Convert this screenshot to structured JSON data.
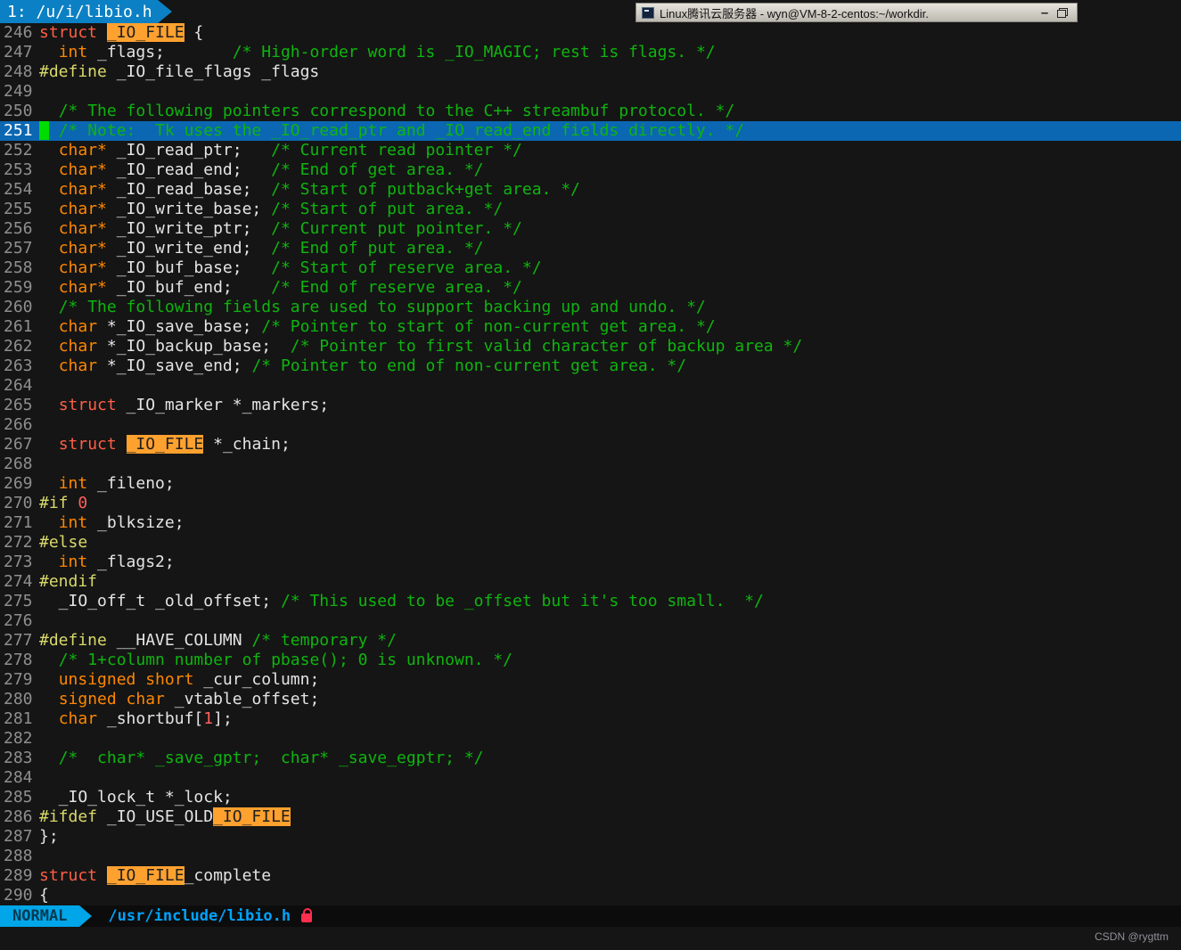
{
  "colors": {
    "bg": "#151515",
    "gutter_fg": "#8f8f8f",
    "text": "#e4e4e4",
    "comment": "#0fb40f",
    "type": "#ff8700",
    "keyword": "#ff5f45",
    "preproc": "#d8d96a",
    "number": "#ff5f5f",
    "search_bg": "#ffa12f",
    "search_fg": "#1f1f1f",
    "cursorline_bg": "#0b67b2",
    "cursorline_num": "#ffffff",
    "cursor_bg": "#00dc00",
    "tab_bg": "#0c80c4",
    "tab_fg": "#ffffff",
    "mode_bg": "#00a6e8",
    "mode_fg": "#063a52",
    "path_fg": "#00a4ff",
    "statusbar_bg": "#0c0c0c",
    "lock_red": "#ff2e4e",
    "titlebar_bg1": "#e6e3dc",
    "titlebar_bg2": "#bcb9b0",
    "watermark_fg": "#90909a"
  },
  "tabline": {
    "active_tab": "1: /u/i/libio.h"
  },
  "titlebar": {
    "title": "Linux腾讯云服务器 - wyn@VM-8-2-centos:~/workdir.",
    "minimize_glyph": "–",
    "app_icon": "terminal-icon",
    "restore_icon": "restore-window-icon"
  },
  "statusbar": {
    "mode": "NORMAL",
    "file_path": "/usr/include/libio.h",
    "readonly_icon": "lock-icon"
  },
  "watermark": "CSDN @rygttm",
  "editor": {
    "cursor_line": 251,
    "search_term": "_IO_FILE",
    "lines": [
      {
        "num": "246",
        "tokens": [
          [
            "struct ",
            "k"
          ],
          [
            "_IO_FILE",
            "h"
          ],
          [
            " {",
            "w"
          ]
        ]
      },
      {
        "num": "247",
        "tokens": [
          [
            "  ",
            "w"
          ],
          [
            "int",
            "t"
          ],
          [
            " _flags;       ",
            "w"
          ],
          [
            "/* High-order word is _IO_MAGIC; rest is flags. */",
            "c"
          ]
        ]
      },
      {
        "num": "248",
        "tokens": [
          [
            "#define",
            "p"
          ],
          [
            " _IO_file_flags _flags",
            "w"
          ]
        ]
      },
      {
        "num": "249",
        "tokens": []
      },
      {
        "num": "250",
        "tokens": [
          [
            "  ",
            "w"
          ],
          [
            "/* The following pointers correspond to the C++ streambuf protocol. */",
            "c"
          ]
        ]
      },
      {
        "num": "251",
        "cursorline": true,
        "tokens": [
          [
            " ",
            "cur"
          ],
          [
            " ",
            "w"
          ],
          [
            "/* Note:  Tk uses the _IO_read_ptr and _IO_read_end fields directly. */",
            "c"
          ]
        ]
      },
      {
        "num": "252",
        "tokens": [
          [
            "  ",
            "w"
          ],
          [
            "char*",
            "t"
          ],
          [
            " _IO_read_ptr;   ",
            "w"
          ],
          [
            "/* Current read pointer */",
            "c"
          ]
        ]
      },
      {
        "num": "253",
        "tokens": [
          [
            "  ",
            "w"
          ],
          [
            "char*",
            "t"
          ],
          [
            " _IO_read_end;   ",
            "w"
          ],
          [
            "/* End of get area. */",
            "c"
          ]
        ]
      },
      {
        "num": "254",
        "tokens": [
          [
            "  ",
            "w"
          ],
          [
            "char*",
            "t"
          ],
          [
            " _IO_read_base;  ",
            "w"
          ],
          [
            "/* Start of putback+get area. */",
            "c"
          ]
        ]
      },
      {
        "num": "255",
        "tokens": [
          [
            "  ",
            "w"
          ],
          [
            "char*",
            "t"
          ],
          [
            " _IO_write_base; ",
            "w"
          ],
          [
            "/* Start of put area. */",
            "c"
          ]
        ]
      },
      {
        "num": "256",
        "tokens": [
          [
            "  ",
            "w"
          ],
          [
            "char*",
            "t"
          ],
          [
            " _IO_write_ptr;  ",
            "w"
          ],
          [
            "/* Current put pointer. */",
            "c"
          ]
        ]
      },
      {
        "num": "257",
        "tokens": [
          [
            "  ",
            "w"
          ],
          [
            "char*",
            "t"
          ],
          [
            " _IO_write_end;  ",
            "w"
          ],
          [
            "/* End of put area. */",
            "c"
          ]
        ]
      },
      {
        "num": "258",
        "tokens": [
          [
            "  ",
            "w"
          ],
          [
            "char*",
            "t"
          ],
          [
            " _IO_buf_base;   ",
            "w"
          ],
          [
            "/* Start of reserve area. */",
            "c"
          ]
        ]
      },
      {
        "num": "259",
        "tokens": [
          [
            "  ",
            "w"
          ],
          [
            "char*",
            "t"
          ],
          [
            " _IO_buf_end;    ",
            "w"
          ],
          [
            "/* End of reserve area. */",
            "c"
          ]
        ]
      },
      {
        "num": "260",
        "tokens": [
          [
            "  ",
            "w"
          ],
          [
            "/* The following fields are used to support backing up and undo. */",
            "c"
          ]
        ]
      },
      {
        "num": "261",
        "tokens": [
          [
            "  ",
            "w"
          ],
          [
            "char",
            "t"
          ],
          [
            " *_IO_save_base; ",
            "w"
          ],
          [
            "/* Pointer to start of non-current get area. */",
            "c"
          ]
        ]
      },
      {
        "num": "262",
        "tokens": [
          [
            "  ",
            "w"
          ],
          [
            "char",
            "t"
          ],
          [
            " *_IO_backup_base;  ",
            "w"
          ],
          [
            "/* Pointer to first valid character of backup area */",
            "c"
          ]
        ]
      },
      {
        "num": "263",
        "tokens": [
          [
            "  ",
            "w"
          ],
          [
            "char",
            "t"
          ],
          [
            " *_IO_save_end; ",
            "w"
          ],
          [
            "/* Pointer to end of non-current get area. */",
            "c"
          ]
        ]
      },
      {
        "num": "264",
        "tokens": []
      },
      {
        "num": "265",
        "tokens": [
          [
            "  ",
            "w"
          ],
          [
            "struct",
            "k"
          ],
          [
            " _IO_marker *_markers;",
            "w"
          ]
        ]
      },
      {
        "num": "266",
        "tokens": []
      },
      {
        "num": "267",
        "tokens": [
          [
            "  ",
            "w"
          ],
          [
            "struct",
            "k"
          ],
          [
            " ",
            "w"
          ],
          [
            "_IO_FILE",
            "h"
          ],
          [
            " *_chain;",
            "w"
          ]
        ]
      },
      {
        "num": "268",
        "tokens": []
      },
      {
        "num": "269",
        "tokens": [
          [
            "  ",
            "w"
          ],
          [
            "int",
            "t"
          ],
          [
            " _fileno;",
            "w"
          ]
        ]
      },
      {
        "num": "270",
        "tokens": [
          [
            "#if",
            "p"
          ],
          [
            " ",
            "w"
          ],
          [
            "0",
            "n"
          ]
        ]
      },
      {
        "num": "271",
        "tokens": [
          [
            "  ",
            "w"
          ],
          [
            "int",
            "t"
          ],
          [
            " _blksize;",
            "w"
          ]
        ]
      },
      {
        "num": "272",
        "tokens": [
          [
            "#else",
            "p"
          ]
        ]
      },
      {
        "num": "273",
        "tokens": [
          [
            "  ",
            "w"
          ],
          [
            "int",
            "t"
          ],
          [
            " _flags2;",
            "w"
          ]
        ]
      },
      {
        "num": "274",
        "tokens": [
          [
            "#endif",
            "p"
          ]
        ]
      },
      {
        "num": "275",
        "tokens": [
          [
            "  _IO_off_t _old_offset; ",
            "w"
          ],
          [
            "/* This used to be _offset but it's too small.  */",
            "c"
          ]
        ]
      },
      {
        "num": "276",
        "tokens": []
      },
      {
        "num": "277",
        "tokens": [
          [
            "#define",
            "p"
          ],
          [
            " __HAVE_COLUMN ",
            "w"
          ],
          [
            "/* temporary */",
            "c"
          ]
        ]
      },
      {
        "num": "278",
        "tokens": [
          [
            "  ",
            "w"
          ],
          [
            "/* 1+column number of pbase(); 0 is unknown. */",
            "c"
          ]
        ]
      },
      {
        "num": "279",
        "tokens": [
          [
            "  ",
            "w"
          ],
          [
            "unsigned short",
            "t"
          ],
          [
            " _cur_column;",
            "w"
          ]
        ]
      },
      {
        "num": "280",
        "tokens": [
          [
            "  ",
            "w"
          ],
          [
            "signed char",
            "t"
          ],
          [
            " _vtable_offset;",
            "w"
          ]
        ]
      },
      {
        "num": "281",
        "tokens": [
          [
            "  ",
            "w"
          ],
          [
            "char",
            "t"
          ],
          [
            " _shortbuf[",
            "w"
          ],
          [
            "1",
            "n"
          ],
          [
            "];",
            "w"
          ]
        ]
      },
      {
        "num": "282",
        "tokens": []
      },
      {
        "num": "283",
        "tokens": [
          [
            "  ",
            "w"
          ],
          [
            "/*  char* _save_gptr;  char* _save_egptr; */",
            "c"
          ]
        ]
      },
      {
        "num": "284",
        "tokens": []
      },
      {
        "num": "285",
        "tokens": [
          [
            "  _IO_lock_t *_lock;",
            "w"
          ]
        ]
      },
      {
        "num": "286",
        "tokens": [
          [
            "#ifdef",
            "p"
          ],
          [
            " _IO_USE_OLD",
            "w"
          ],
          [
            "_IO_FILE",
            "h"
          ]
        ]
      },
      {
        "num": "287",
        "tokens": [
          [
            "};",
            "w"
          ]
        ]
      },
      {
        "num": "288",
        "tokens": []
      },
      {
        "num": "289",
        "tokens": [
          [
            "struct ",
            "k"
          ],
          [
            "_IO_FILE",
            "h"
          ],
          [
            "_complete",
            "w"
          ]
        ]
      },
      {
        "num": "290",
        "tokens": [
          [
            "{",
            "w"
          ]
        ]
      }
    ]
  }
}
